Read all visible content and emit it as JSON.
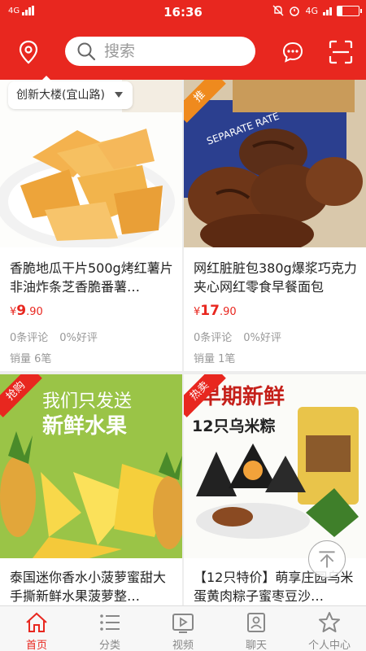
{
  "status_bar": {
    "network_left": "4G",
    "time": "16:36",
    "network_right": "4G"
  },
  "header": {
    "search_placeholder": "搜索",
    "location_popup": "创新大楼(宜山路)"
  },
  "products": [
    {
      "title": "香脆地瓜干片500g烤红薯片非油炸条芝香脆番薯…",
      "price_symbol": "¥",
      "price_int": "9",
      "price_dec": ".90",
      "reviews": "0条评论",
      "positive_rate": "0%好评",
      "sales": "销量 6笔",
      "badge": ""
    },
    {
      "title": "网红脏脏包380g爆浆巧克力夹心网红零食早餐面包",
      "price_symbol": "¥",
      "price_int": "17",
      "price_dec": ".90",
      "reviews": "0条评论",
      "positive_rate": "0%好评",
      "sales": "销量 1笔",
      "badge": "推",
      "image_text": "SEPARATE RATE"
    },
    {
      "title": "泰国迷你香水小菠萝蜜甜大手撕新鲜水果菠萝整…",
      "badge": "抢购",
      "image_text_1": "我们只发送",
      "image_text_2": "新鲜水果"
    },
    {
      "title": "【12只特价】萌享庄园乌米蛋黄肉粽子蜜枣豆沙…",
      "badge": "热卖",
      "image_text_1": "早期新鲜",
      "image_text_2": "12只乌米粽"
    }
  ],
  "tabs": [
    {
      "label": "首页",
      "icon": "home-icon"
    },
    {
      "label": "分类",
      "icon": "category-list-icon"
    },
    {
      "label": "视频",
      "icon": "video-icon"
    },
    {
      "label": "聊天",
      "icon": "chat-contact-icon"
    },
    {
      "label": "个人中心",
      "icon": "star-profile-icon"
    }
  ],
  "colors": {
    "brand_red": "#e8271f",
    "tab_inactive": "#888888"
  }
}
